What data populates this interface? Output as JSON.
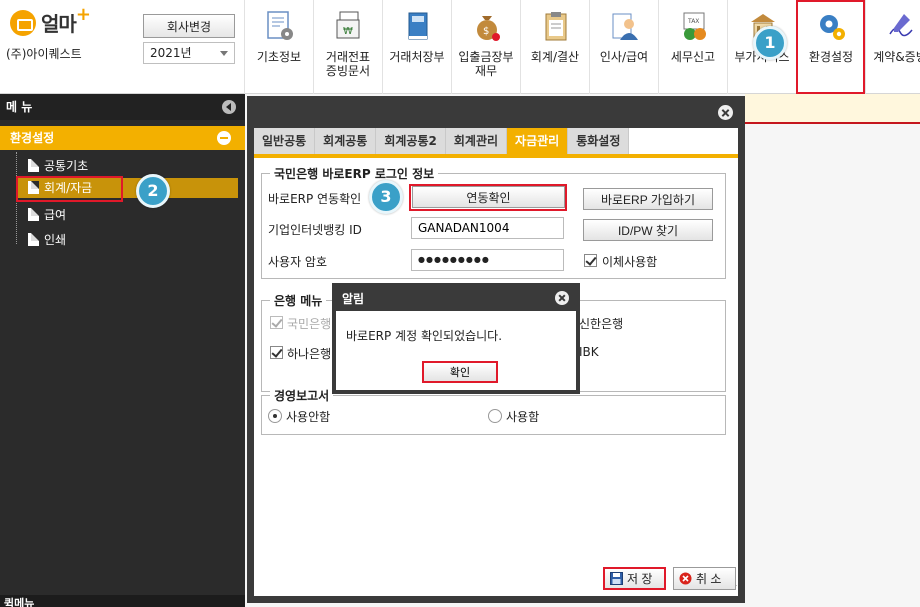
{
  "app": {
    "brand": "얼마",
    "company": "(주)아이퀘스트",
    "company_change_label": "회사변경",
    "year": "2021년"
  },
  "top_menu": [
    {
      "label": "기초정보",
      "icon": "settings-document-icon"
    },
    {
      "label": "거래전표\n증빙문서",
      "icon": "voucher-icon"
    },
    {
      "label": "거래처장부",
      "icon": "ledger-book-icon"
    },
    {
      "label": "입출금장부\n재무",
      "icon": "money-bag-icon"
    },
    {
      "label": "회계/결산",
      "icon": "clipboard-icon"
    },
    {
      "label": "인사/급여",
      "icon": "employee-icon"
    },
    {
      "label": "세무신고",
      "icon": "tax-icon"
    },
    {
      "label": "부가서비스",
      "icon": "building-icon"
    },
    {
      "label": "환경설정",
      "icon": "gears-icon"
    },
    {
      "label": "계약&증빙",
      "icon": "pen-signature-icon"
    }
  ],
  "sidebar": {
    "header": "메 뉴",
    "section": "환경설정",
    "items": [
      "공통기초",
      "회계/자금",
      "급여",
      "인쇄"
    ],
    "bottom": "퀵메뉴"
  },
  "badges": [
    "1",
    "2",
    "3"
  ],
  "dialog": {
    "tabs": [
      "일반공통",
      "회계공통",
      "회계공통2",
      "회계관리",
      "자금관리",
      "통화설정"
    ],
    "login_group": {
      "title": "국민은행 바로ERP 로그인 정보",
      "erp_link_label": "바로ERP 연동확인",
      "link_check_button": "연동확인",
      "join_button": "바로ERP 가입하기",
      "banking_id_label": "기업인터넷뱅킹 ID",
      "banking_id_value": "GANADAN1004",
      "find_idpw_button": "ID/PW 찾기",
      "password_label": "사용자 암호",
      "password_value": "●●●●●●●●●",
      "transfer_label": "이체사용함"
    },
    "bank_menu_group": {
      "title": "은행 메뉴",
      "kb_label": "국민은행",
      "shinhan_label": "신한은행",
      "hana_label": "하나은행",
      "ibk_label": "IBK"
    },
    "report_group": {
      "title": "경영보고서",
      "opt_off": "사용안함",
      "opt_on": "사용함"
    },
    "save_button": "저 장",
    "cancel_button": "취 소"
  },
  "alert": {
    "title": "알림",
    "message": "바로ERP 계정 확인되었습니다.",
    "ok_button": "확인"
  }
}
